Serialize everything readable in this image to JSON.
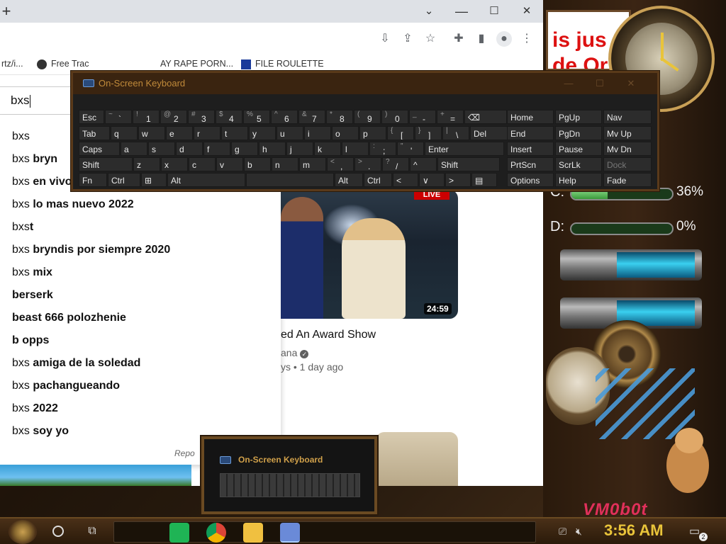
{
  "browser": {
    "new_tab_glyph": "+",
    "window_controls": {
      "minimize": "⌄",
      "maximize": "☐",
      "close": "✕"
    },
    "bookmarks": [
      {
        "label": "rtz/i..."
      },
      {
        "label": "Free Trac"
      },
      {
        "label": "AY RAPE PORN..."
      },
      {
        "label": "FILE ROULETTE"
      }
    ],
    "search": {
      "value": "bxs"
    },
    "suggestions": [
      {
        "prefix": "bxs",
        "rest": ""
      },
      {
        "prefix": "bxs",
        "rest": " bryn"
      },
      {
        "prefix": "bxs",
        "rest": " en vivo"
      },
      {
        "prefix": "bxs",
        "rest": " lo mas nuevo 2022"
      },
      {
        "prefix": "bxs",
        "rest": "t"
      },
      {
        "prefix": "bxs",
        "rest": " bryndis por siempre 2020"
      },
      {
        "prefix": "bxs",
        "rest": " mix"
      },
      {
        "prefix": "",
        "rest": "berserk"
      },
      {
        "prefix": "",
        "rest": "beast 666 polozhenie"
      },
      {
        "prefix": "",
        "rest": "b opps"
      },
      {
        "prefix": "bxs",
        "rest": " amiga de la soledad"
      },
      {
        "prefix": "bxs",
        "rest": " pachangueando"
      },
      {
        "prefix": "bxs",
        "rest": " 2022"
      },
      {
        "prefix": "bxs",
        "rest": " soy yo"
      }
    ],
    "report_label": "Repo",
    "video": {
      "live_badge": "LIVE",
      "duration": "24:59",
      "title": "ed An Award Show",
      "channel": "ana",
      "meta": "ys • 1 day ago"
    }
  },
  "osk": {
    "title": "On-Screen Keyboard",
    "rows": [
      [
        {
          "label": "Esc"
        },
        {
          "sup": "~",
          "main": "`"
        },
        {
          "sup": "!",
          "main": "1"
        },
        {
          "sup": "@",
          "main": "2"
        },
        {
          "sup": "#",
          "main": "3"
        },
        {
          "sup": "$",
          "main": "4"
        },
        {
          "sup": "%",
          "main": "5"
        },
        {
          "sup": "^",
          "main": "6"
        },
        {
          "sup": "&",
          "main": "7"
        },
        {
          "sup": "*",
          "main": "8"
        },
        {
          "sup": "(",
          "main": "9"
        },
        {
          "sup": ")",
          "main": "0"
        },
        {
          "sup": "_",
          "main": "-"
        },
        {
          "sup": "+",
          "main": "="
        },
        {
          "label": "⌫"
        }
      ],
      [
        {
          "label": "Tab"
        },
        {
          "label": "q"
        },
        {
          "label": "w"
        },
        {
          "label": "e"
        },
        {
          "label": "r"
        },
        {
          "label": "t"
        },
        {
          "label": "y"
        },
        {
          "label": "u"
        },
        {
          "label": "i"
        },
        {
          "label": "o"
        },
        {
          "label": "p"
        },
        {
          "sup": "{",
          "main": "["
        },
        {
          "sup": "}",
          "main": "]"
        },
        {
          "sup": "|",
          "main": "\\"
        },
        {
          "label": "Del"
        }
      ],
      [
        {
          "label": "Caps"
        },
        {
          "label": "a"
        },
        {
          "label": "s"
        },
        {
          "label": "d"
        },
        {
          "label": "f"
        },
        {
          "label": "g"
        },
        {
          "label": "h"
        },
        {
          "label": "j"
        },
        {
          "label": "k"
        },
        {
          "label": "l"
        },
        {
          "sup": ":",
          "main": ";"
        },
        {
          "sup": "\"",
          "main": "'"
        },
        {
          "label": "Enter"
        }
      ],
      [
        {
          "label": "Shift"
        },
        {
          "label": "z"
        },
        {
          "label": "x"
        },
        {
          "label": "c"
        },
        {
          "label": "v"
        },
        {
          "label": "b"
        },
        {
          "label": "n"
        },
        {
          "label": "m"
        },
        {
          "sup": "<",
          "main": ","
        },
        {
          "sup": ">",
          "main": "."
        },
        {
          "sup": "?",
          "main": "/"
        },
        {
          "label": "^"
        },
        {
          "label": "Shift"
        }
      ],
      [
        {
          "label": "Fn"
        },
        {
          "label": "Ctrl"
        },
        {
          "label": "⊞"
        },
        {
          "label": "Alt"
        },
        {
          "label": ""
        },
        {
          "label": "Alt"
        },
        {
          "label": "Ctrl"
        },
        {
          "label": "<"
        },
        {
          "label": "∨"
        },
        {
          "label": ">"
        },
        {
          "label": "▤"
        }
      ]
    ],
    "nav_keys": [
      [
        "Home",
        "PgUp",
        "Nav"
      ],
      [
        "End",
        "PgDn",
        "Mv Up"
      ],
      [
        "Insert",
        "Pause",
        "Mv Dn"
      ],
      [
        "PrtScn",
        "ScrLk",
        "Dock"
      ],
      [
        "Options",
        "Help",
        "Fade"
      ]
    ]
  },
  "osk_thumb": {
    "title": "On-Screen Keyboard"
  },
  "desktop": {
    "sign_text": "is jus\nde Or",
    "gauges": [
      {
        "letter": "C:",
        "percent_label": "36%",
        "fill": 0.36
      },
      {
        "letter": "D:",
        "percent_label": "0%",
        "fill": 0.0
      }
    ],
    "watermark": "VM0b0t"
  },
  "taskbar": {
    "time": "3:56 AM",
    "notification_count": "2"
  }
}
